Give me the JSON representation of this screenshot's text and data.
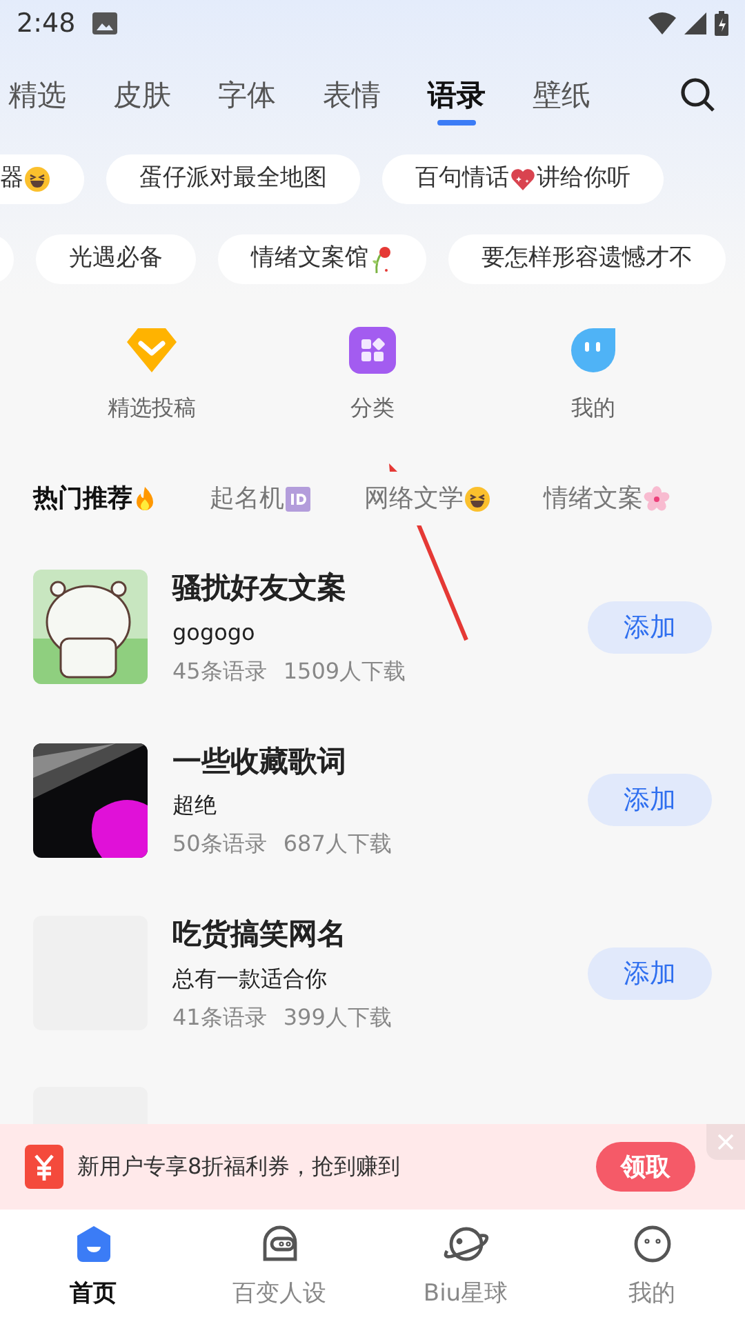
{
  "status_bar": {
    "time": "2:48"
  },
  "tabs": [
    {
      "label": "精选",
      "selected": false
    },
    {
      "label": "皮肤",
      "selected": false
    },
    {
      "label": "字体",
      "selected": false
    },
    {
      "label": "表情",
      "selected": false
    },
    {
      "label": "语录",
      "selected": true
    },
    {
      "label": "壁纸",
      "selected": false
    }
  ],
  "chip_rows": [
    [
      {
        "text": "器",
        "kind": "laugh"
      },
      {
        "text": "蛋仔派对最全地图",
        "kind": "plain"
      },
      {
        "text": "百句情话",
        "after": "讲给你听",
        "kind": "heart"
      }
    ],
    [
      {
        "text": "光遇必备",
        "kind": "plain"
      },
      {
        "text": "情绪文案馆",
        "kind": "rose"
      },
      {
        "text": "要怎样形容遗憾才不",
        "kind": "plain"
      }
    ]
  ],
  "shortcuts": [
    {
      "label": "精选投稿",
      "kind": "gem"
    },
    {
      "label": "分类",
      "kind": "grid"
    },
    {
      "label": "我的",
      "kind": "drop"
    }
  ],
  "sub_tabs": [
    {
      "label": "热门推荐",
      "kind": "fire",
      "selected": true
    },
    {
      "label": "起名机",
      "kind": "id",
      "selected": false
    },
    {
      "label": "网络文学",
      "kind": "laugh",
      "selected": false
    },
    {
      "label": "情绪文案",
      "kind": "flower",
      "selected": false
    }
  ],
  "collections": [
    {
      "title": "骚扰好友文案",
      "subtitle": "gogogo",
      "count": "45条语录",
      "downloads": "1509人下载",
      "button": "添加",
      "kind": "picture"
    },
    {
      "title": "一些收藏歌词",
      "subtitle": "超绝",
      "count": "50条语录",
      "downloads": "687人下载",
      "button": "添加",
      "kind": "picture"
    },
    {
      "title": "吃货搞笑网名",
      "subtitle": "总有一款适合你",
      "count": "41条语录",
      "downloads": "399人下载",
      "button": "添加",
      "kind": "placeholder"
    },
    {
      "kind": "placeholder"
    }
  ],
  "banner": {
    "text": "新用户专享8折福利券，抢到赚到",
    "button": "领取"
  },
  "bottom_nav": [
    {
      "label": "首页",
      "kind": "home",
      "selected": true
    },
    {
      "label": "百变人设",
      "kind": "helmet",
      "selected": false
    },
    {
      "label": "Biu星球",
      "kind": "planet",
      "selected": false
    },
    {
      "label": "我的",
      "kind": "face",
      "selected": false
    }
  ]
}
